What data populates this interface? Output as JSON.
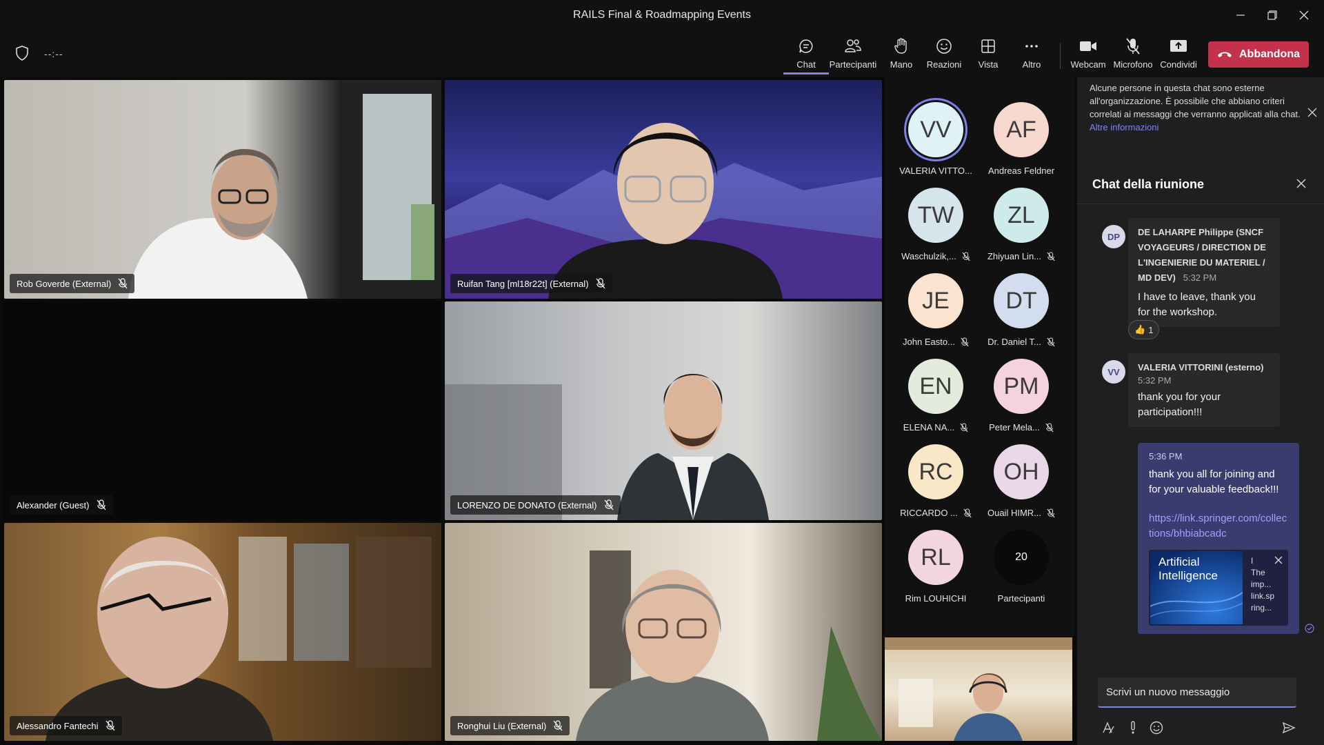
{
  "window": {
    "title": "RAILS Final & Roadmapping Events"
  },
  "toolbar": {
    "timer": "--:--",
    "items": [
      {
        "label": "Chat",
        "icon": "chat-icon"
      },
      {
        "label": "Partecipanti",
        "icon": "people-icon"
      },
      {
        "label": "Mano",
        "icon": "raise-hand-icon"
      },
      {
        "label": "Reazioni",
        "icon": "smiley-icon"
      },
      {
        "label": "Vista",
        "icon": "grid-view-icon"
      },
      {
        "label": "Altro",
        "icon": "more-icon"
      },
      {
        "label": "Webcam",
        "icon": "camera-icon"
      },
      {
        "label": "Microfono",
        "icon": "mic-off-icon"
      },
      {
        "label": "Condividi",
        "icon": "share-icon"
      }
    ],
    "leave_label": "Abbandona"
  },
  "video_tiles": [
    {
      "name": "Rob Goverde (External)"
    },
    {
      "name": "Ruifan Tang [ml18r22t] (External)"
    },
    {
      "name": "Alexander (Guest)"
    },
    {
      "name": "LORENZO DE DONATO (External)"
    },
    {
      "name": "Alessandro Fantechi"
    },
    {
      "name": "Ronghui Liu (External)"
    }
  ],
  "roster": [
    {
      "initials": "VV",
      "name": "VALERIA VITTO...",
      "color": "#dff2f5",
      "muted": false
    },
    {
      "initials": "AF",
      "name": "Andreas Feldner",
      "color": "#f7d8cf",
      "muted": false
    },
    {
      "initials": "TW",
      "name": "Waschulzik,...",
      "color": "#d6e4ec",
      "muted": true
    },
    {
      "initials": "ZL",
      "name": "Zhiyuan Lin...",
      "color": "#cfeaea",
      "muted": true
    },
    {
      "initials": "JE",
      "name": "John Easto...",
      "color": "#fbe3cf",
      "muted": true
    },
    {
      "initials": "DT",
      "name": "Dr. Daniel T...",
      "color": "#d2def0",
      "muted": true
    },
    {
      "initials": "EN",
      "name": "ELENA NA...",
      "color": "#e3ecdc",
      "muted": true
    },
    {
      "initials": "PM",
      "name": "Peter Mela...",
      "color": "#f5d3dc",
      "muted": true
    },
    {
      "initials": "RC",
      "name": "RICCARDO ...",
      "color": "#f9e8c7",
      "muted": true
    },
    {
      "initials": "OH",
      "name": "Ouail HIMR...",
      "color": "#ead8e8",
      "muted": true
    },
    {
      "initials": "RL",
      "name": "Rim LOUHICHI",
      "color": "#f3d5e1",
      "muted": false
    },
    {
      "initials": "20",
      "name": "Partecipanti",
      "color": "#0a0a0a",
      "muted": false
    }
  ],
  "chat": {
    "notice": "Alcune persone in questa chat sono esterne all'organizzazione. È possibile che abbiano criteri correlati ai messaggi che verranno applicati alla chat.",
    "notice_link": "Altre informazioni",
    "header": "Chat della riunione",
    "messages": [
      {
        "avatar": "DP",
        "author": "DE LAHARPE Philippe (SNCF VOYAGEURS / DIRECTION DE L'INGENIERIE DU MATERIEL / MD DEV)",
        "time": "5:32 PM",
        "text": "I have to leave, thank you for the workshop.",
        "reaction": "👍",
        "reaction_count": "1"
      },
      {
        "avatar": "VV",
        "author": "VALERIA VITTORINI (esterno)",
        "time": "5:32 PM",
        "text": "thank you for your participation!!!"
      }
    ],
    "own_message": {
      "time": "5:36 PM",
      "text": "thank you all for joining and for your valuable feedback!!!",
      "link": "https://link.springer.com/collections/bhbiabcadc",
      "preview_image_text": "Artificial Intelligence",
      "preview_lines": [
        "I",
        "The",
        "imp...",
        "link.sp",
        "ring..."
      ]
    },
    "compose_placeholder": "Scrivi un nuovo messaggio"
  },
  "colors": {
    "accent": "#7b83eb",
    "leave": "#c4314b",
    "own_bubble": "#3a3b6e"
  }
}
